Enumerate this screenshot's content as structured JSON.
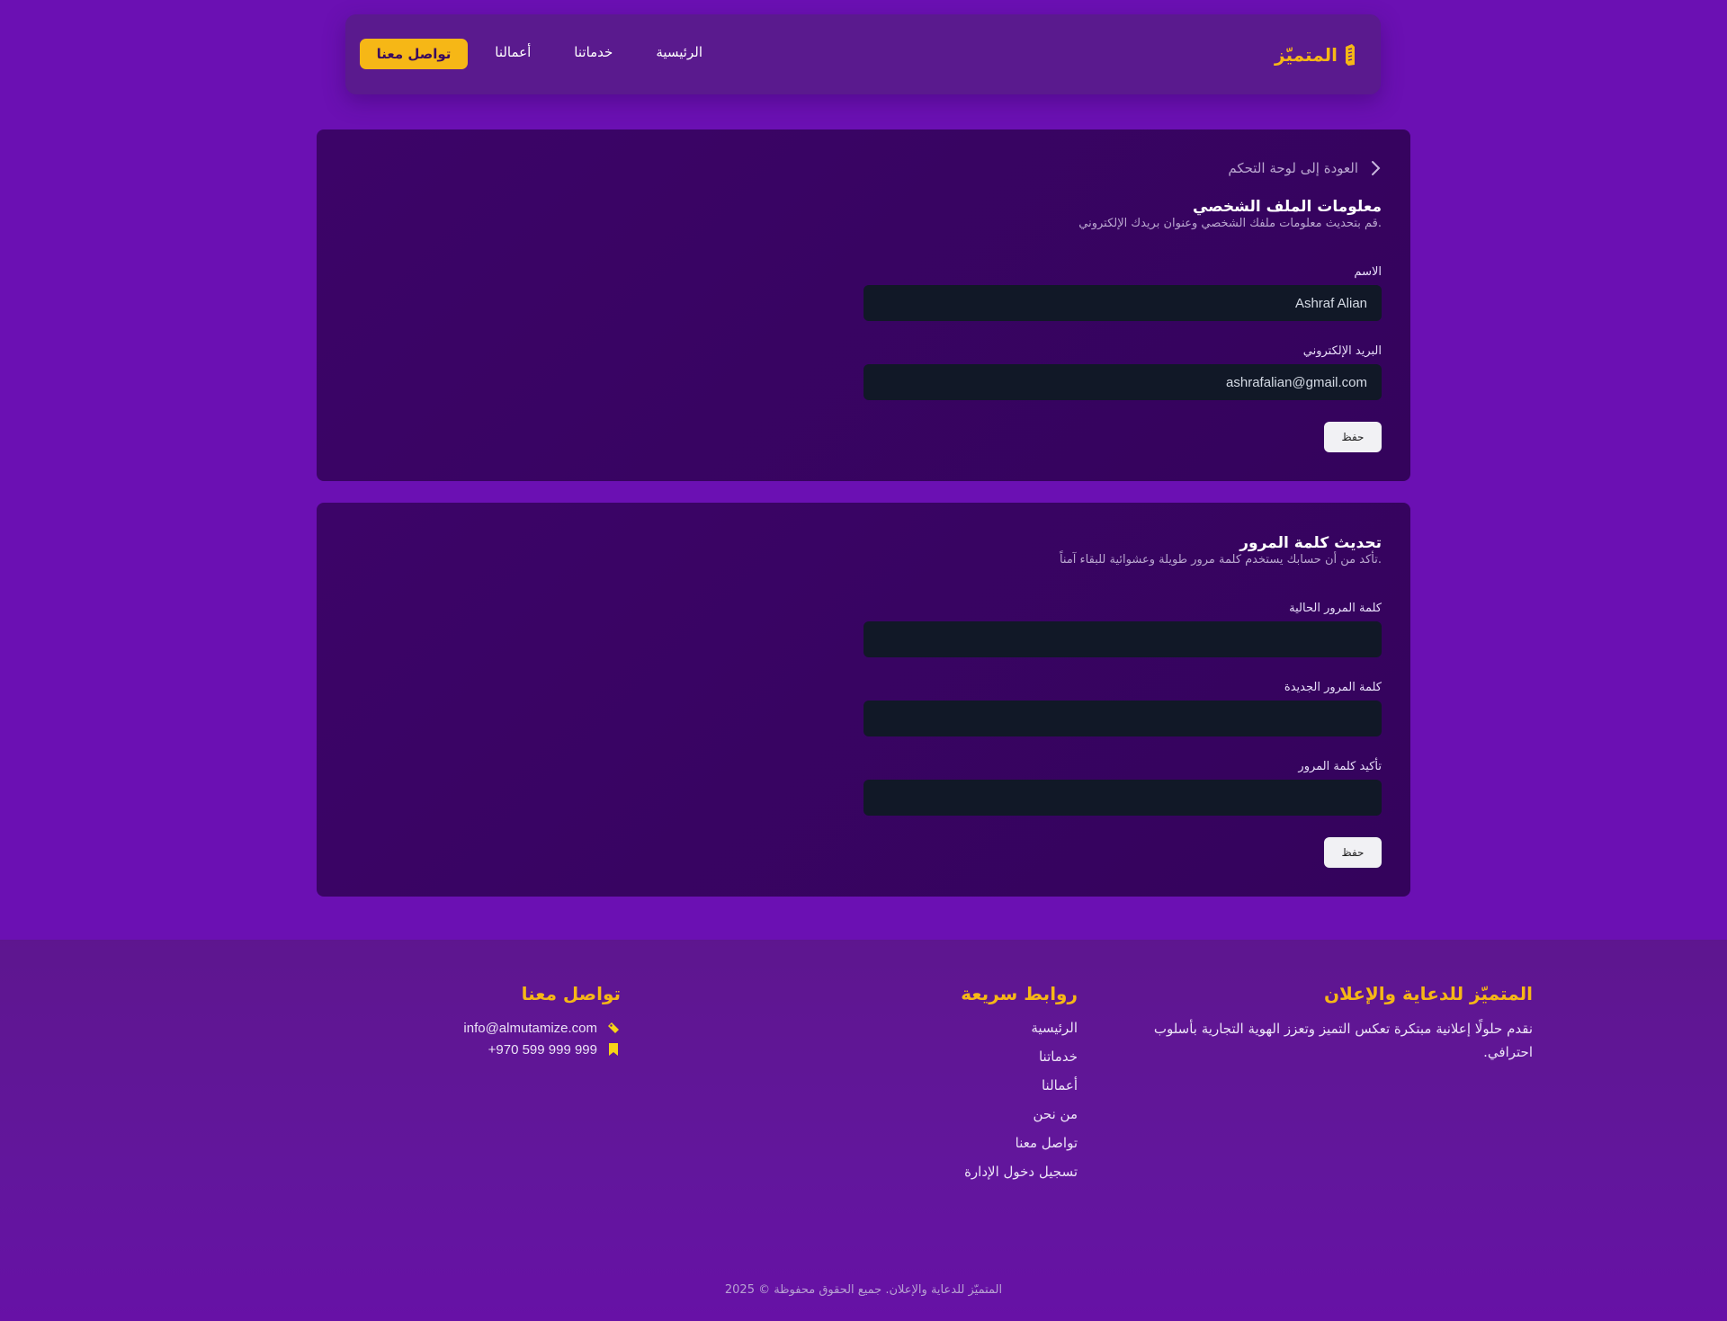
{
  "brand": {
    "name": "المتميّز",
    "accent_color": "#f6b716"
  },
  "nav": {
    "links": [
      "الرئيسية",
      "خدماتنا",
      "أعمالنا"
    ],
    "cta_label": "تواصل معنا"
  },
  "profile_card": {
    "back_link": "العودة إلى لوحة التحكم",
    "title": "معلومات الملف الشخصي",
    "description": "قم بتحديث معلومات ملفك الشخصي وعنوان بريدك الإلكتروني.",
    "name_label": "الاسم",
    "name_value": "Ashraf Alian",
    "email_label": "البريد الإلكتروني",
    "email_value": "ashrafalian@gmail.com",
    "save_label": "حفظ"
  },
  "password_card": {
    "title": "تحديث كلمة المرور",
    "description": "تأكد من أن حسابك يستخدم كلمة مرور طويلة وعشوائية للبقاء آمناً.",
    "current_label": "كلمة المرور الحالية",
    "new_label": "كلمة المرور الجديدة",
    "confirm_label": "تأكيد كلمة المرور",
    "current_value": "",
    "new_value": "",
    "confirm_value": "",
    "save_label": "حفظ"
  },
  "footer": {
    "about_title": "المتميّز للدعاية والإعلان",
    "about_text": "نقدم حلولًا إعلانية مبتكرة تعكس التميز وتعزز الهوية التجارية بأسلوب احترافي.",
    "links_title": "روابط سريعة",
    "links": [
      "الرئيسية",
      "خدماتنا",
      "أعمالنا",
      "من نحن",
      "تواصل معنا",
      "تسجيل دخول الإدارة"
    ],
    "contact_title": "تواصل معنا",
    "email": "info@almutamize.com",
    "email_icon": "tag-icon",
    "phone": "+970 599 999 999",
    "phone_icon": "bookmark-icon",
    "copyright": "المتميّز للدعاية والإعلان. جميع الحقوق محفوظة © 2025"
  }
}
